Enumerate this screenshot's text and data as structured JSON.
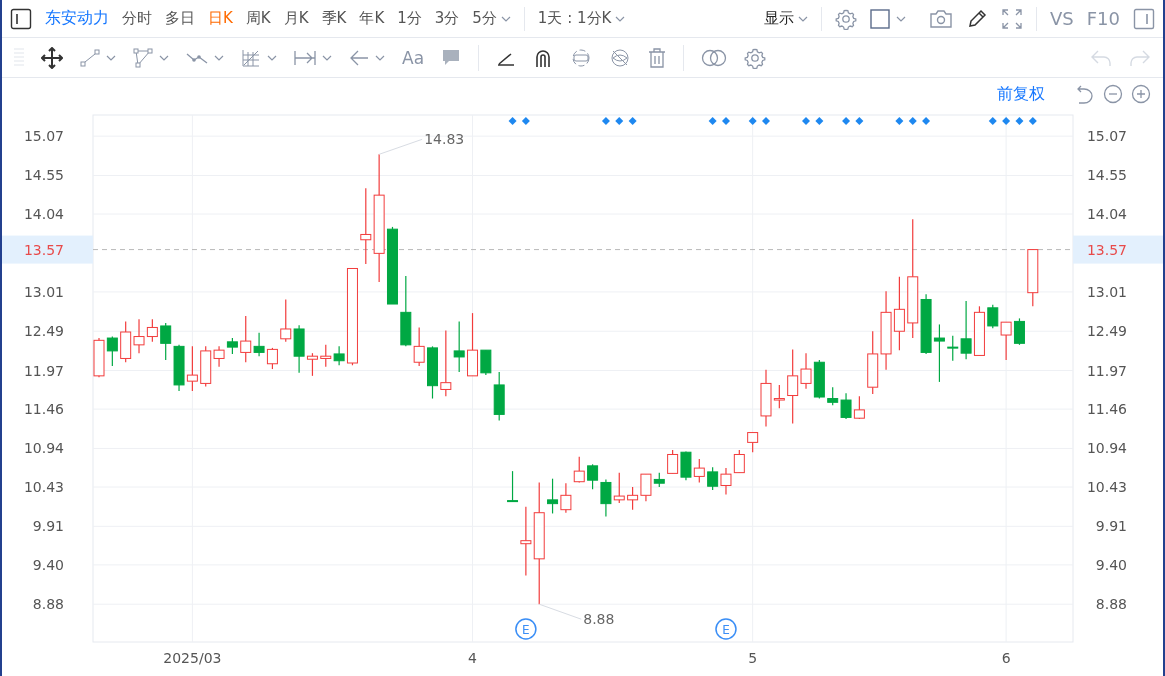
{
  "header": {
    "stock_name": "东安动力",
    "periods": [
      {
        "label": "分时",
        "selected": false,
        "dropdown": false
      },
      {
        "label": "多日",
        "selected": false,
        "dropdown": false
      },
      {
        "label": "日K",
        "selected": true,
        "dropdown": false
      },
      {
        "label": "周K",
        "selected": false,
        "dropdown": false
      },
      {
        "label": "月K",
        "selected": false,
        "dropdown": false
      },
      {
        "label": "季K",
        "selected": false,
        "dropdown": false
      },
      {
        "label": "年K",
        "selected": false,
        "dropdown": false
      },
      {
        "label": "1分",
        "selected": false,
        "dropdown": false
      },
      {
        "label": "3分",
        "selected": false,
        "dropdown": false
      },
      {
        "label": "5分",
        "selected": false,
        "dropdown": true
      }
    ],
    "interval": "1天 : 1分K",
    "display": "显示",
    "compare": "VS",
    "f10": "F10"
  },
  "drawing_toolbar": {
    "text_tool": "Aa",
    "undo": {
      "disabled": true
    },
    "redo": {
      "disabled": true
    }
  },
  "adjustment": "前复权",
  "candle_markers": [
    {
      "signal": false,
      "event": false
    },
    {
      "signal": false,
      "event": false
    },
    {
      "signal": false,
      "event": false
    },
    {
      "signal": false,
      "event": false
    },
    {
      "signal": false,
      "event": false
    },
    {
      "signal": false,
      "event": false
    },
    {
      "signal": false,
      "event": false
    },
    {
      "signal": false,
      "event": false
    },
    {
      "signal": false,
      "event": false
    },
    {
      "signal": false,
      "event": false
    },
    {
      "signal": false,
      "event": false
    },
    {
      "signal": false,
      "event": false
    },
    {
      "signal": false,
      "event": false
    },
    {
      "signal": false,
      "event": false
    },
    {
      "signal": false,
      "event": false
    },
    {
      "signal": false,
      "event": false
    },
    {
      "signal": false,
      "event": false
    },
    {
      "signal": false,
      "event": false
    },
    {
      "signal": false,
      "event": false
    },
    {
      "signal": false,
      "event": false
    },
    {
      "signal": false,
      "event": false
    },
    {
      "signal": false,
      "event": false
    },
    {
      "signal": false,
      "event": false
    },
    {
      "signal": false,
      "event": false
    },
    {
      "signal": false,
      "event": false
    },
    {
      "signal": false,
      "event": false
    },
    {
      "signal": false,
      "event": false
    },
    {
      "signal": false,
      "event": false
    },
    {
      "signal": false,
      "event": false
    },
    {
      "signal": false,
      "event": false
    },
    {
      "signal": false,
      "event": false
    },
    {
      "signal": true,
      "event": false
    },
    {
      "signal": true,
      "event": true
    },
    {
      "signal": false,
      "event": false
    },
    {
      "signal": false,
      "event": false
    },
    {
      "signal": false,
      "event": false
    },
    {
      "signal": false,
      "event": false
    },
    {
      "signal": false,
      "event": false
    },
    {
      "signal": true,
      "event": false
    },
    {
      "signal": true,
      "event": false
    },
    {
      "signal": true,
      "event": false
    },
    {
      "signal": false,
      "event": false
    },
    {
      "signal": false,
      "event": false
    },
    {
      "signal": false,
      "event": false
    },
    {
      "signal": false,
      "event": false
    },
    {
      "signal": false,
      "event": false
    },
    {
      "signal": true,
      "event": false
    },
    {
      "signal": true,
      "event": true
    },
    {
      "signal": false,
      "event": false
    },
    {
      "signal": true,
      "event": false
    },
    {
      "signal": true,
      "event": false
    },
    {
      "signal": false,
      "event": false
    },
    {
      "signal": false,
      "event": false
    },
    {
      "signal": true,
      "event": false
    },
    {
      "signal": true,
      "event": false
    },
    {
      "signal": false,
      "event": false
    },
    {
      "signal": true,
      "event": false
    },
    {
      "signal": true,
      "event": false
    },
    {
      "signal": false,
      "event": false
    },
    {
      "signal": false,
      "event": false
    },
    {
      "signal": true,
      "event": false
    },
    {
      "signal": true,
      "event": false
    },
    {
      "signal": true,
      "event": false
    },
    {
      "signal": false,
      "event": false
    },
    {
      "signal": false,
      "event": false
    },
    {
      "signal": false,
      "event": false
    },
    {
      "signal": false,
      "event": false
    },
    {
      "signal": true,
      "event": false
    },
    {
      "signal": true,
      "event": false
    },
    {
      "signal": true,
      "event": false
    },
    {
      "signal": true,
      "event": false
    }
  ],
  "event_labels": [
    "E",
    "E"
  ],
  "right_axis_labels": [
    "15.07",
    "14.55",
    "14.04",
    "13.01",
    "12.49",
    "11.97",
    "11.46",
    "10.94",
    "10.43",
    "9.91",
    "9.40",
    "8.88"
  ],
  "right_price_label": "13.57",
  "chart_data": {
    "type": "candlestick",
    "grid": true,
    "ylim": [
      8.38,
      15.35
    ],
    "yticks": [
      {
        "value": 15.07,
        "label": "15.07"
      },
      {
        "value": 14.55,
        "label": "14.55"
      },
      {
        "value": 14.04,
        "label": "14.04"
      },
      {
        "value": 13.01,
        "label": "13.01"
      },
      {
        "value": 12.49,
        "label": "12.49"
      },
      {
        "value": 11.97,
        "label": "11.97"
      },
      {
        "value": 11.46,
        "label": "11.46"
      },
      {
        "value": 10.94,
        "label": "10.94"
      },
      {
        "value": 10.43,
        "label": "10.43"
      },
      {
        "value": 9.91,
        "label": "9.91"
      },
      {
        "value": 9.4,
        "label": "9.40"
      },
      {
        "value": 8.88,
        "label": "8.88"
      }
    ],
    "categories": [
      null,
      null,
      null,
      null,
      null,
      null,
      null,
      "2025/03",
      null,
      null,
      null,
      null,
      null,
      null,
      null,
      null,
      null,
      null,
      null,
      null,
      null,
      null,
      null,
      null,
      null,
      null,
      null,
      null,
      "4",
      null,
      null,
      null,
      null,
      null,
      null,
      null,
      null,
      null,
      null,
      null,
      null,
      null,
      null,
      null,
      null,
      null,
      null,
      null,
      null,
      "5",
      null,
      null,
      null,
      null,
      null,
      null,
      null,
      null,
      null,
      null,
      null,
      null,
      null,
      null,
      null,
      null,
      null,
      null,
      "6",
      null,
      null
    ],
    "ohlc": [
      [
        11.9,
        12.4,
        11.88,
        12.37
      ],
      [
        12.4,
        12.42,
        12.03,
        12.23
      ],
      [
        12.13,
        12.62,
        12.08,
        12.48
      ],
      [
        12.31,
        12.65,
        12.2,
        12.42
      ],
      [
        12.42,
        12.65,
        12.35,
        12.54
      ],
      [
        12.56,
        12.6,
        12.11,
        12.33
      ],
      [
        12.29,
        12.31,
        11.7,
        11.78
      ],
      [
        11.83,
        12.29,
        11.7,
        11.91
      ],
      [
        11.8,
        12.29,
        11.76,
        12.23
      ],
      [
        12.13,
        12.29,
        12.02,
        12.24
      ],
      [
        12.35,
        12.4,
        12.19,
        12.28
      ],
      [
        12.21,
        12.69,
        12.08,
        12.36
      ],
      [
        12.29,
        12.47,
        12.16,
        12.21
      ],
      [
        12.06,
        12.27,
        11.99,
        12.25
      ],
      [
        12.39,
        12.91,
        12.35,
        12.52
      ],
      [
        12.52,
        12.57,
        11.94,
        12.16
      ],
      [
        12.12,
        12.2,
        11.9,
        12.16
      ],
      [
        12.13,
        12.31,
        12.02,
        12.16
      ],
      [
        12.19,
        12.29,
        12.04,
        12.1
      ],
      [
        12.07,
        13.32,
        12.04,
        13.32
      ],
      [
        13.7,
        14.38,
        13.38,
        13.77
      ],
      [
        13.52,
        14.83,
        13.14,
        14.29
      ],
      [
        13.84,
        13.87,
        12.85,
        12.85
      ],
      [
        12.74,
        13.22,
        12.29,
        12.31
      ],
      [
        12.08,
        12.54,
        12.03,
        12.29
      ],
      [
        12.27,
        12.29,
        11.6,
        11.77
      ],
      [
        11.72,
        12.5,
        11.63,
        11.81
      ],
      [
        12.23,
        12.62,
        11.95,
        12.15
      ],
      [
        11.9,
        12.73,
        11.9,
        12.24
      ],
      [
        12.24,
        12.24,
        11.91,
        11.94
      ],
      [
        11.78,
        11.95,
        11.31,
        11.39
      ],
      [
        10.25,
        10.64,
        10.24,
        10.24
      ],
      [
        9.68,
        10.17,
        9.26,
        9.72
      ],
      [
        9.48,
        10.49,
        8.88,
        10.09
      ],
      [
        10.26,
        10.54,
        10.08,
        10.21
      ],
      [
        10.13,
        10.48,
        10.09,
        10.32
      ],
      [
        10.5,
        10.83,
        10.49,
        10.64
      ],
      [
        10.71,
        10.73,
        10.4,
        10.52
      ],
      [
        10.49,
        10.53,
        10.04,
        10.21
      ],
      [
        10.26,
        10.62,
        10.22,
        10.31
      ],
      [
        10.26,
        10.43,
        10.13,
        10.32
      ],
      [
        10.32,
        10.6,
        10.24,
        10.6
      ],
      [
        10.53,
        10.62,
        10.43,
        10.48
      ],
      [
        10.61,
        10.92,
        10.61,
        10.86
      ],
      [
        10.89,
        10.9,
        10.52,
        10.56
      ],
      [
        10.57,
        10.8,
        10.49,
        10.68
      ],
      [
        10.63,
        10.69,
        10.39,
        10.44
      ],
      [
        10.45,
        10.68,
        10.33,
        10.6
      ],
      [
        10.62,
        10.92,
        10.62,
        10.86
      ],
      [
        11.02,
        11.15,
        10.89,
        11.15
      ],
      [
        11.37,
        11.98,
        11.23,
        11.8
      ],
      [
        11.58,
        11.78,
        11.47,
        11.6
      ],
      [
        11.64,
        12.25,
        11.27,
        11.9
      ],
      [
        11.8,
        12.2,
        11.73,
        11.99
      ],
      [
        12.08,
        12.11,
        11.6,
        11.62
      ],
      [
        11.6,
        11.75,
        11.51,
        11.55
      ],
      [
        11.58,
        11.67,
        11.33,
        11.35
      ],
      [
        11.34,
        11.63,
        11.33,
        11.45
      ],
      [
        11.75,
        12.49,
        11.66,
        12.19
      ],
      [
        12.19,
        13.02,
        11.98,
        12.74
      ],
      [
        12.49,
        13.21,
        12.24,
        12.78
      ],
      [
        12.6,
        13.97,
        12.4,
        13.21
      ],
      [
        12.91,
        12.98,
        12.19,
        12.21
      ],
      [
        12.4,
        12.58,
        11.82,
        12.36
      ],
      [
        12.28,
        12.43,
        12.1,
        12.28
      ],
      [
        12.39,
        12.89,
        12.12,
        12.2
      ],
      [
        12.17,
        12.82,
        12.17,
        12.74
      ],
      [
        12.8,
        12.84,
        12.53,
        12.56
      ],
      [
        12.44,
        12.61,
        12.11,
        12.61
      ],
      [
        12.62,
        12.66,
        12.31,
        12.33
      ],
      [
        13.0,
        13.57,
        12.82,
        13.57
      ]
    ],
    "ref_lines": [
      {
        "axis": "y",
        "value": 13.57,
        "label": "13.57"
      }
    ],
    "annotations": [
      "14.83",
      "8.88"
    ]
  }
}
